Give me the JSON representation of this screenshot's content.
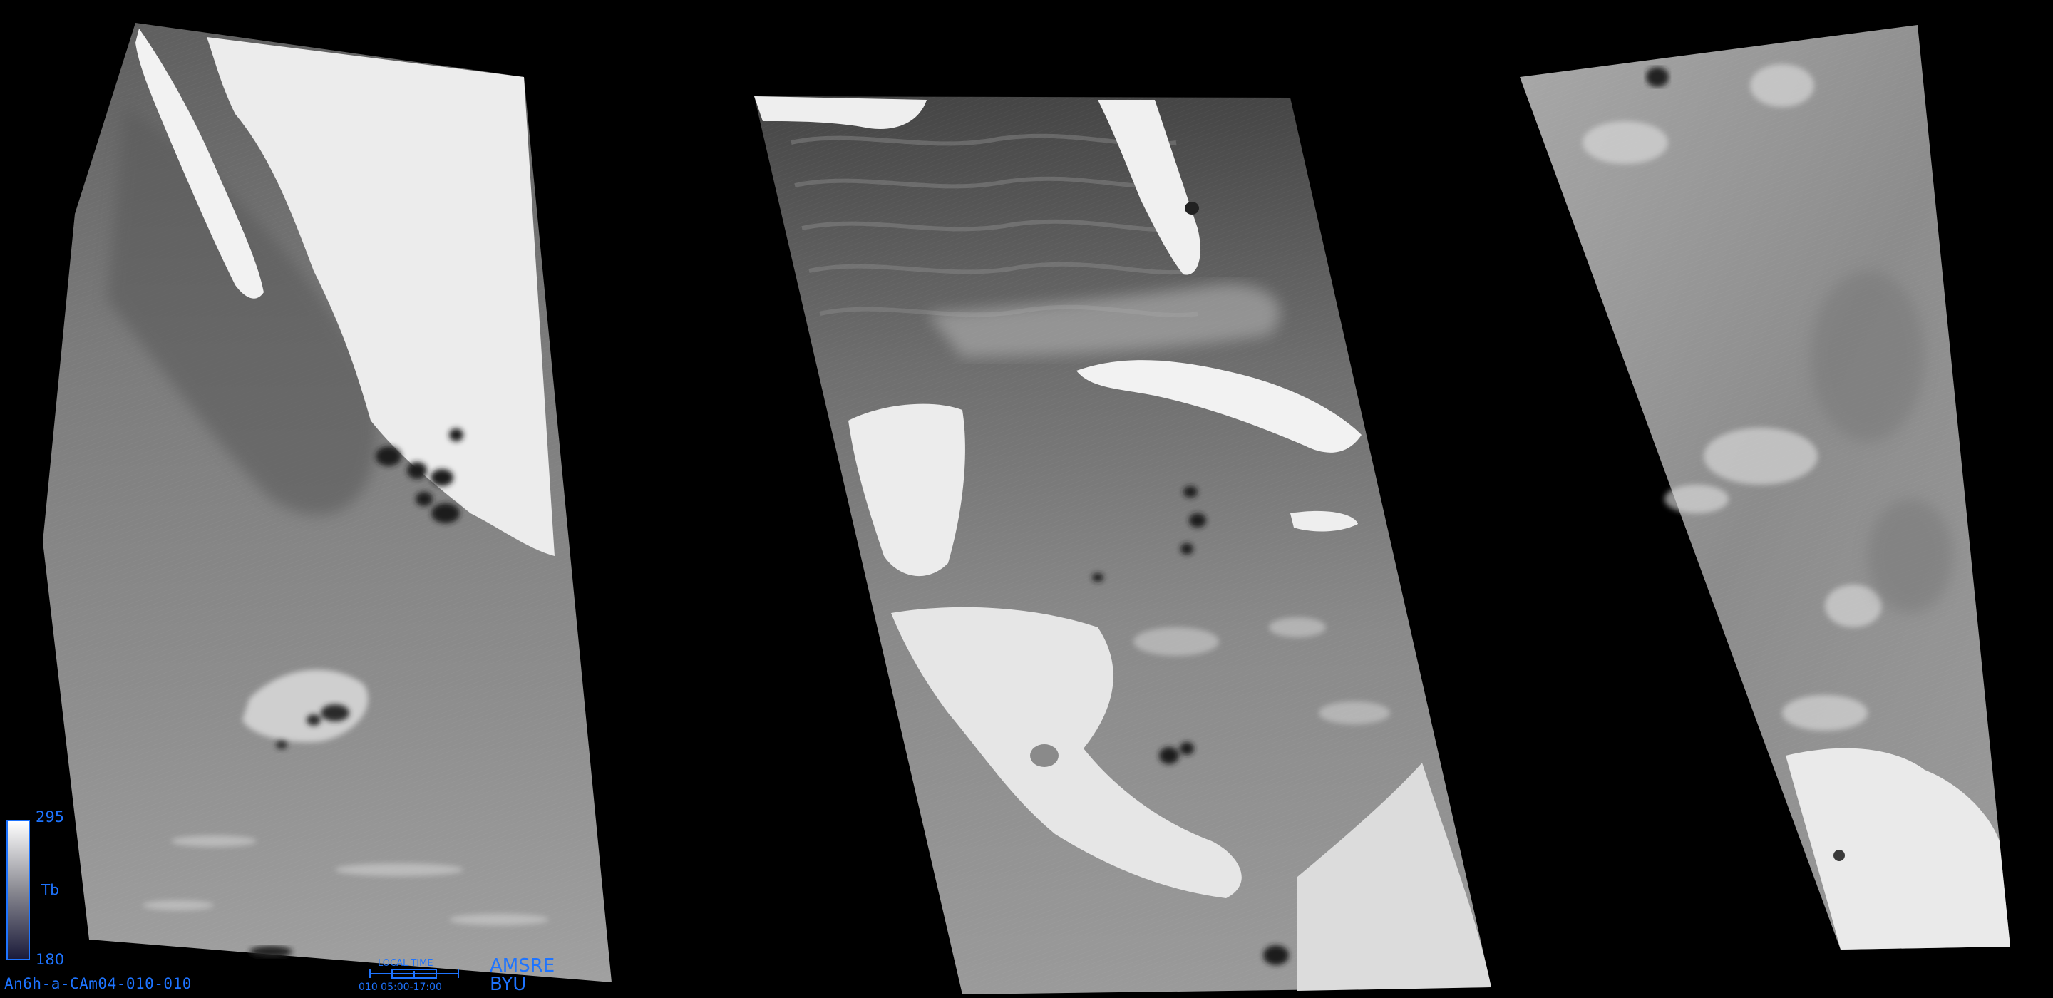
{
  "image_id": "An6h-a-CAm04-010-010",
  "sensor": "AMSRE",
  "institution": "BYU",
  "colorbar": {
    "max": "295",
    "min": "180",
    "label": "Tb"
  },
  "local_time": {
    "title": "LOCAL TIME",
    "range": "010 05:00-17:00"
  },
  "colors": {
    "background": "#000000",
    "annotation": "#1e74ff"
  }
}
